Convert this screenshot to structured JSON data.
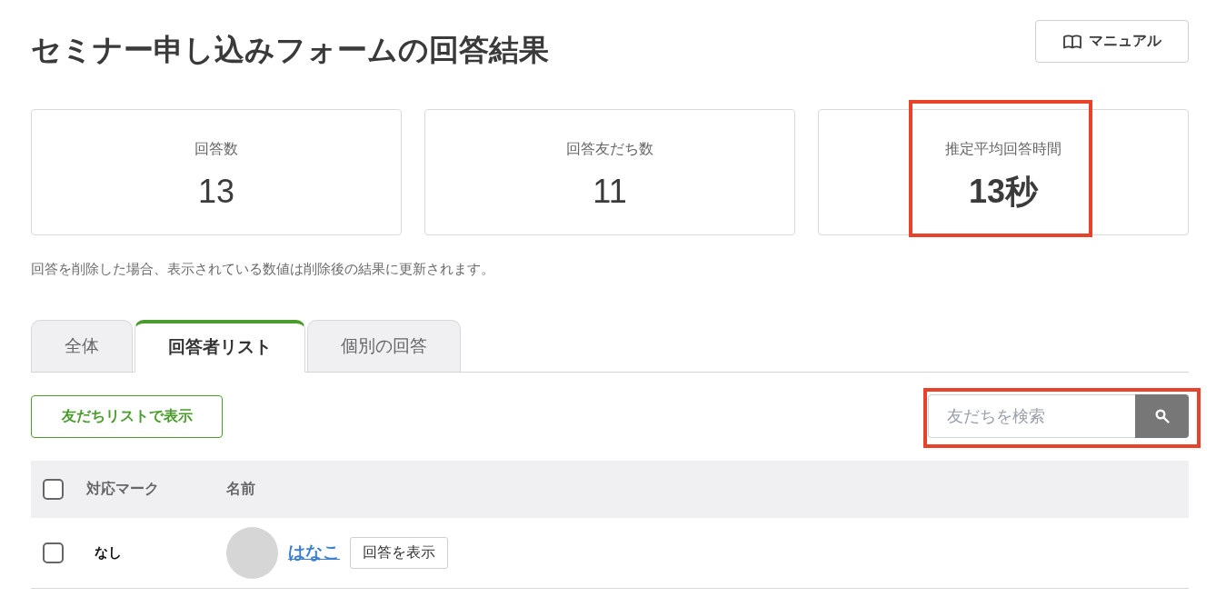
{
  "header": {
    "title": "セミナー申し込みフォームの回答結果",
    "manual_button": "マニュアル"
  },
  "stats": [
    {
      "label": "回答数",
      "value": "13",
      "highlighted": false
    },
    {
      "label": "回答友だち数",
      "value": "11",
      "highlighted": false
    },
    {
      "label": "推定平均回答時間",
      "value": "13秒",
      "highlighted": true
    }
  ],
  "note": "回答を削除した場合、表示されている数値は削除後の結果に更新されます。",
  "tabs": [
    {
      "label": "全体",
      "selected": false
    },
    {
      "label": "回答者リスト",
      "selected": true
    },
    {
      "label": "個別の回答",
      "selected": false
    }
  ],
  "toolbar": {
    "friends_list_button": "友だちリストで表示",
    "search": {
      "placeholder": "友だちを検索",
      "highlighted": true
    }
  },
  "table": {
    "select_all_checked": false,
    "columns": [
      "対応マーク",
      "名前"
    ],
    "rows": [
      {
        "checked": false,
        "mark": "なし",
        "name": "はなこ",
        "view_button": "回答を表示"
      }
    ]
  }
}
